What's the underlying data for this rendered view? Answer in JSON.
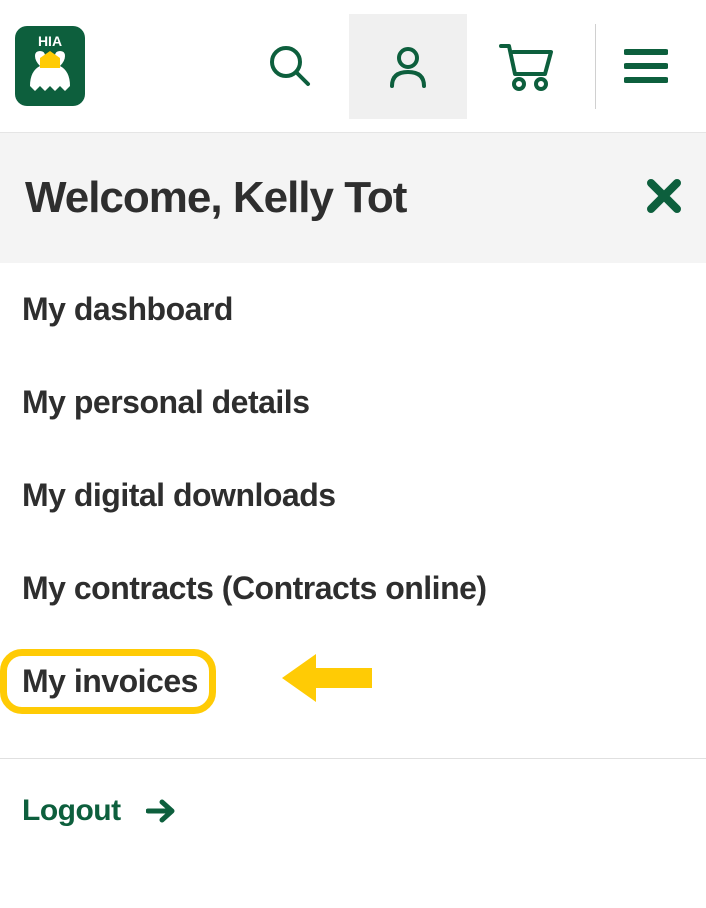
{
  "header": {
    "logo_label": "HIA"
  },
  "welcome": {
    "greeting": "Welcome, Kelly Tot"
  },
  "menu": {
    "items": [
      {
        "label": "My dashboard"
      },
      {
        "label": "My personal details"
      },
      {
        "label": "My digital downloads"
      },
      {
        "label": "My contracts (Contracts online)"
      },
      {
        "label": "My invoices",
        "highlighted": true
      }
    ]
  },
  "logout": {
    "label": "Logout"
  },
  "colors": {
    "brand_green": "#0d5f3d",
    "highlight_yellow": "#ffcb05",
    "text_dark": "#2e2e2e"
  }
}
